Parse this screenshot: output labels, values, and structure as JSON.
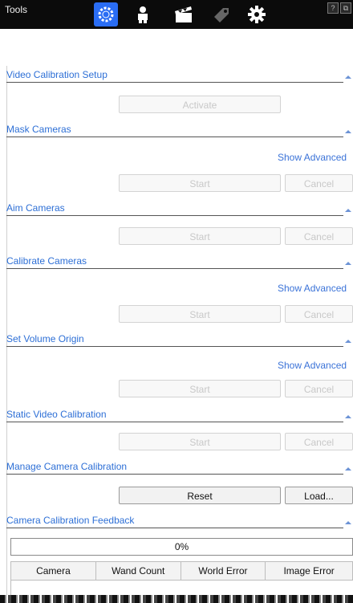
{
  "window": {
    "title": "Tools"
  },
  "toolbar": {
    "buttons": [
      {
        "icon": "camera-calibration-icon",
        "active": true
      },
      {
        "icon": "person-icon",
        "active": false
      },
      {
        "icon": "clapperboard-icon",
        "active": false
      },
      {
        "icon": "tag-icon",
        "active": false
      },
      {
        "icon": "gear-icon",
        "active": false
      }
    ]
  },
  "sections": {
    "video_calibration_setup": {
      "title": "Video Calibration Setup",
      "activate_label": "Activate"
    },
    "mask_cameras": {
      "title": "Mask Cameras",
      "show_advanced": "Show Advanced",
      "start_label": "Start",
      "cancel_label": "Cancel"
    },
    "aim_cameras": {
      "title": "Aim Cameras",
      "start_label": "Start",
      "cancel_label": "Cancel"
    },
    "calibrate_cameras": {
      "title": "Calibrate Cameras",
      "show_advanced": "Show Advanced",
      "start_label": "Start",
      "cancel_label": "Cancel"
    },
    "set_volume_origin": {
      "title": "Set Volume Origin",
      "show_advanced": "Show Advanced",
      "start_label": "Start",
      "cancel_label": "Cancel"
    },
    "static_video_calibration": {
      "title": "Static Video Calibration",
      "start_label": "Start",
      "cancel_label": "Cancel"
    },
    "manage_camera_calibration": {
      "title": "Manage Camera Calibration",
      "reset_label": "Reset",
      "load_label": "Load..."
    },
    "camera_calibration_feedback": {
      "title": "Camera Calibration Feedback",
      "progress_text": "0%",
      "progress_value": 0,
      "columns": [
        "Camera",
        "Wand Count",
        "World Error",
        "Image Error"
      ]
    }
  },
  "colors": {
    "accent": "#2a6df4",
    "section_title": "#2d6fd6",
    "titlebar": "#0b0b0b"
  }
}
